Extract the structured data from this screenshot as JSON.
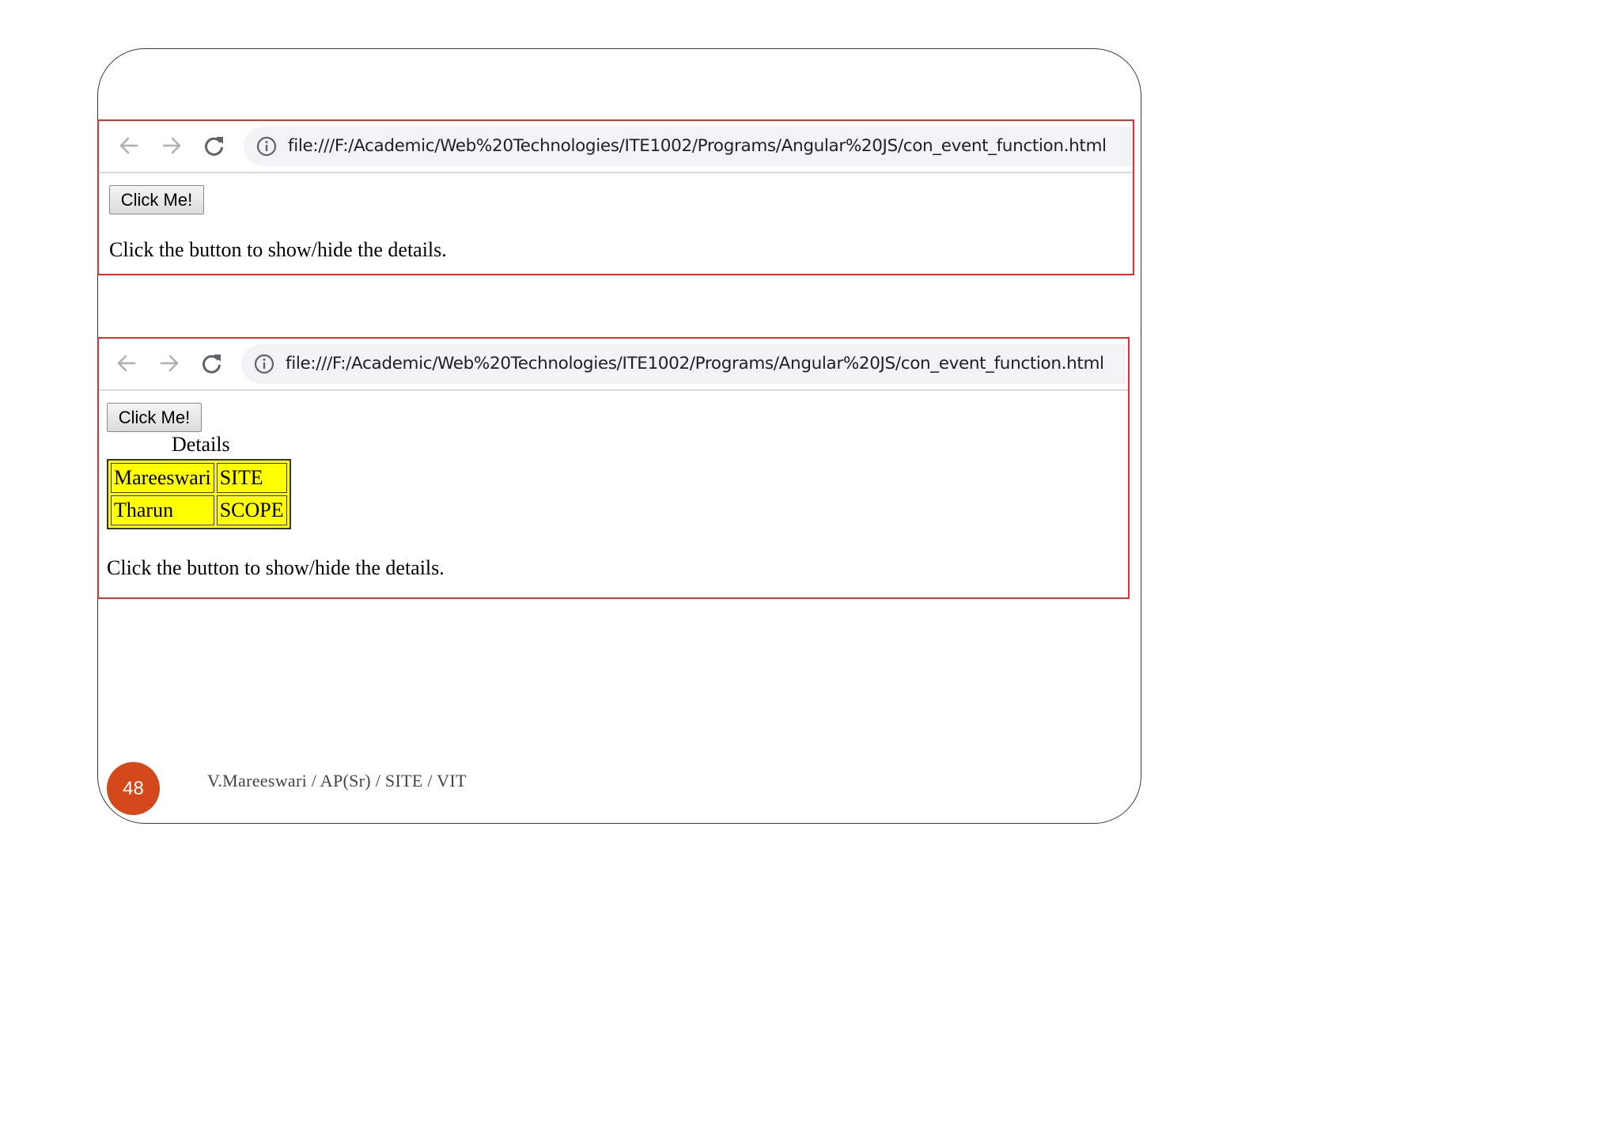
{
  "browser_top": {
    "url": "file:///F:/Academic/Web%20Technologies/ITE1002/Programs/Angular%20JS/con_event_function.html",
    "button_label": "Click Me!",
    "help_text": "Click the button to show/hide the details."
  },
  "browser_bottom": {
    "url": "file:///F:/Academic/Web%20Technologies/ITE1002/Programs/Angular%20JS/con_event_function.html",
    "button_label": "Click Me!",
    "table_caption": "Details",
    "rows": [
      {
        "name": "Mareeswari",
        "dept": "SITE"
      },
      {
        "name": "Tharun",
        "dept": "SCOPE"
      }
    ],
    "help_text": "Click the button to show/hide the details."
  },
  "footer": {
    "page_number": "48",
    "author_text": "V.Mareeswari  / AP(Sr)  / SITE / VIT"
  },
  "colors": {
    "frame_border": "#e03030",
    "table_fill": "#ffff00",
    "page_badge": "#d4491c"
  },
  "icons": [
    "back-arrow-icon",
    "forward-arrow-icon",
    "reload-icon",
    "info-icon"
  ]
}
